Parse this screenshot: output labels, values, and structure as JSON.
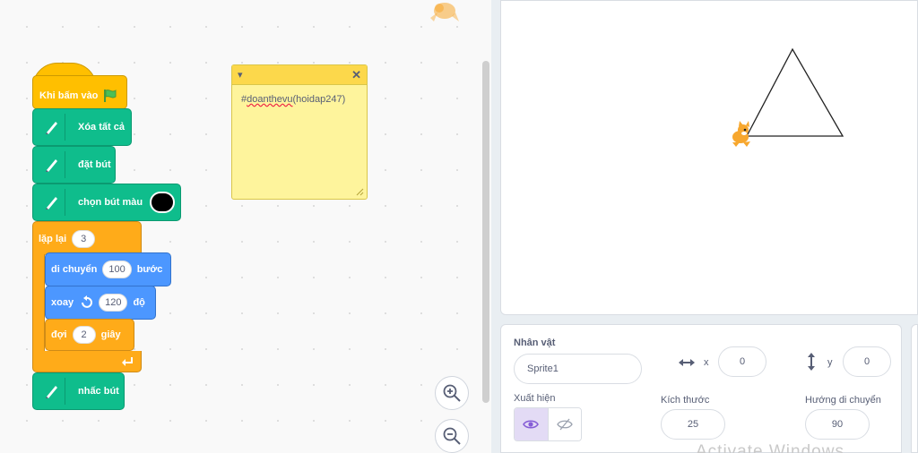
{
  "code": {
    "event_label": "Khi bấm vào",
    "pen_clear": "Xóa tất cả",
    "pen_down": "đặt bút",
    "pen_color": "chọn bút màu",
    "repeat_label": "lặp lại",
    "repeat_count": "3",
    "move_label": "di chuyển",
    "move_steps": "100",
    "move_unit": "bước",
    "turn_label": "xoay",
    "turn_degrees": "120",
    "turn_unit": "độ",
    "wait_label": "đợi",
    "wait_seconds": "2",
    "wait_unit": "giây",
    "pen_up": "nhấc bút"
  },
  "note": {
    "text_prefix": "#",
    "text_underlined": "doanthevu",
    "text_suffix": "(hoidap247)"
  },
  "sprite_panel": {
    "sprite_label": "Nhân vật",
    "sprite_name": "Sprite1",
    "x_label": "x",
    "x_value": "0",
    "y_label": "y",
    "y_value": "0",
    "show_label": "Xuất hiện",
    "size_label": "Kích thước",
    "size_value": "25",
    "direction_label": "Hướng di chuyển",
    "direction_value": "90"
  },
  "watermark": "Activate Windows",
  "colors": {
    "event": "#ffbf00",
    "pen": "#0fbd8c",
    "control": "#ffab19",
    "motion": "#4c97ff",
    "note": "#fef49c",
    "accent": "#855cd6"
  },
  "icons": {
    "event_flag": "green-flag-icon",
    "pen": "pen-icon",
    "turn": "rotate-left-icon",
    "repeat_arrow": "loop-arrow-icon",
    "zoom_in": "zoom-in-icon",
    "zoom_out": "zoom-out-icon",
    "show": "eye-icon",
    "hide": "eye-slash-icon",
    "x_arrow": "horizontal-arrow-icon",
    "y_arrow": "vertical-arrow-icon",
    "note_collapse": "caret-down-icon",
    "note_close": "close-icon"
  }
}
